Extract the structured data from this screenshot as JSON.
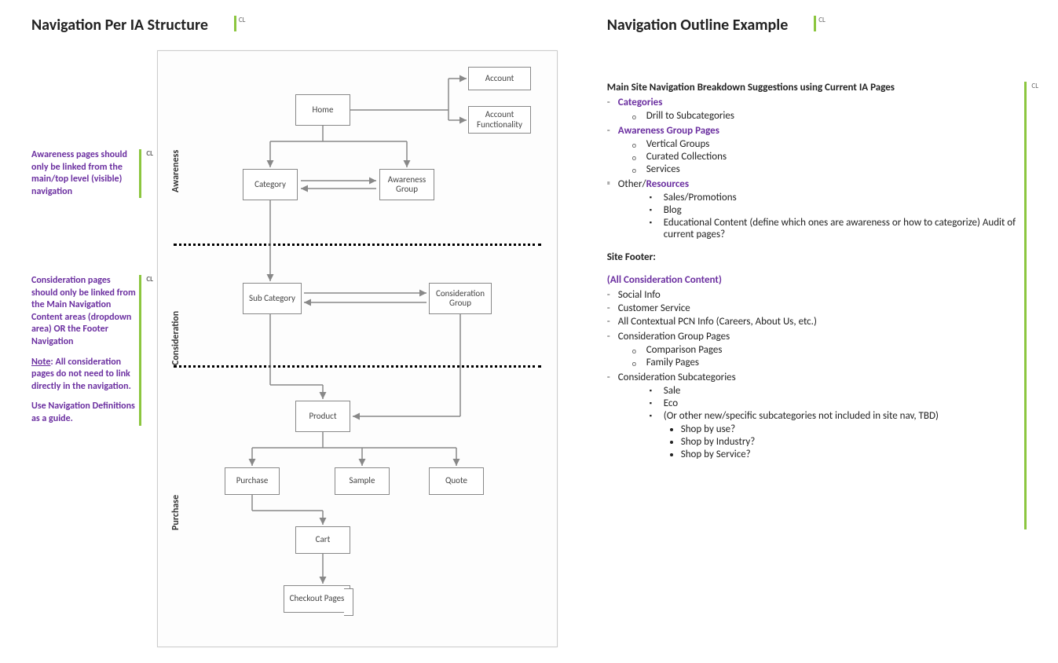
{
  "left": {
    "title": "Navigation Per IA Structure",
    "cl": "CL",
    "note1": "Awareness pages should only be linked from the main/top level (visible) navigation",
    "note2": {
      "p1": "Consideration pages should only be linked from the Main Navigation Content areas (dropdown area) OR the Footer Navigation",
      "p2_label": "Note",
      "p2_rest": ": All consideration pages do not need to link directly in the navigation.",
      "p3": "Use Navigation Definitions as a guide."
    },
    "vlabels": {
      "awareness": "Awareness",
      "consideration": "Consideration",
      "purchase": "Purchase"
    },
    "nodes": {
      "home": "Home",
      "account": "Account",
      "account_func": "Account Functionality",
      "category": "Category",
      "awareness_group": "Awareness Group",
      "sub_category": "Sub Category",
      "consideration_group": "Consideration Group",
      "product": "Product",
      "purchase": "Purchase",
      "sample": "Sample",
      "quote": "Quote",
      "cart": "Cart",
      "checkout": "Checkout Pages"
    }
  },
  "right": {
    "title": "Navigation Outline Example",
    "cl": "CL",
    "section_title": "Main Site Navigation Breakdown Suggestions using Current IA Pages",
    "categories": {
      "label": "Categories",
      "items": [
        "Drill to Subcategories"
      ]
    },
    "awareness_group": {
      "label": "Awareness Group Pages",
      "items": [
        "Vertical Groups",
        "Curated Collections",
        "Services"
      ]
    },
    "other": {
      "prefix": "Other/",
      "label": "Resources",
      "items": [
        "Sales/Promotions",
        "Blog",
        "Educational Content (define which ones are awareness or how to categorize) Audit of current pages?"
      ]
    },
    "footer_title": "Site Footer:",
    "all_consideration": "(All Consideration Content)",
    "footer_top": [
      "Social Info",
      "Customer Service",
      "All Contextual PCN Info (Careers, About Us, etc.)"
    ],
    "consideration_group": {
      "label": "Consideration Group Pages",
      "items": [
        "Comparison Pages",
        "Family Pages"
      ]
    },
    "consideration_sub": {
      "label": "Consideration Subcategories",
      "items": [
        "Sale",
        "Eco",
        "(Or other new/specific subcategories not included in site nav, TBD)"
      ],
      "sub": [
        "Shop by use?",
        "Shop by Industry?",
        "Shop by Service?"
      ]
    }
  }
}
